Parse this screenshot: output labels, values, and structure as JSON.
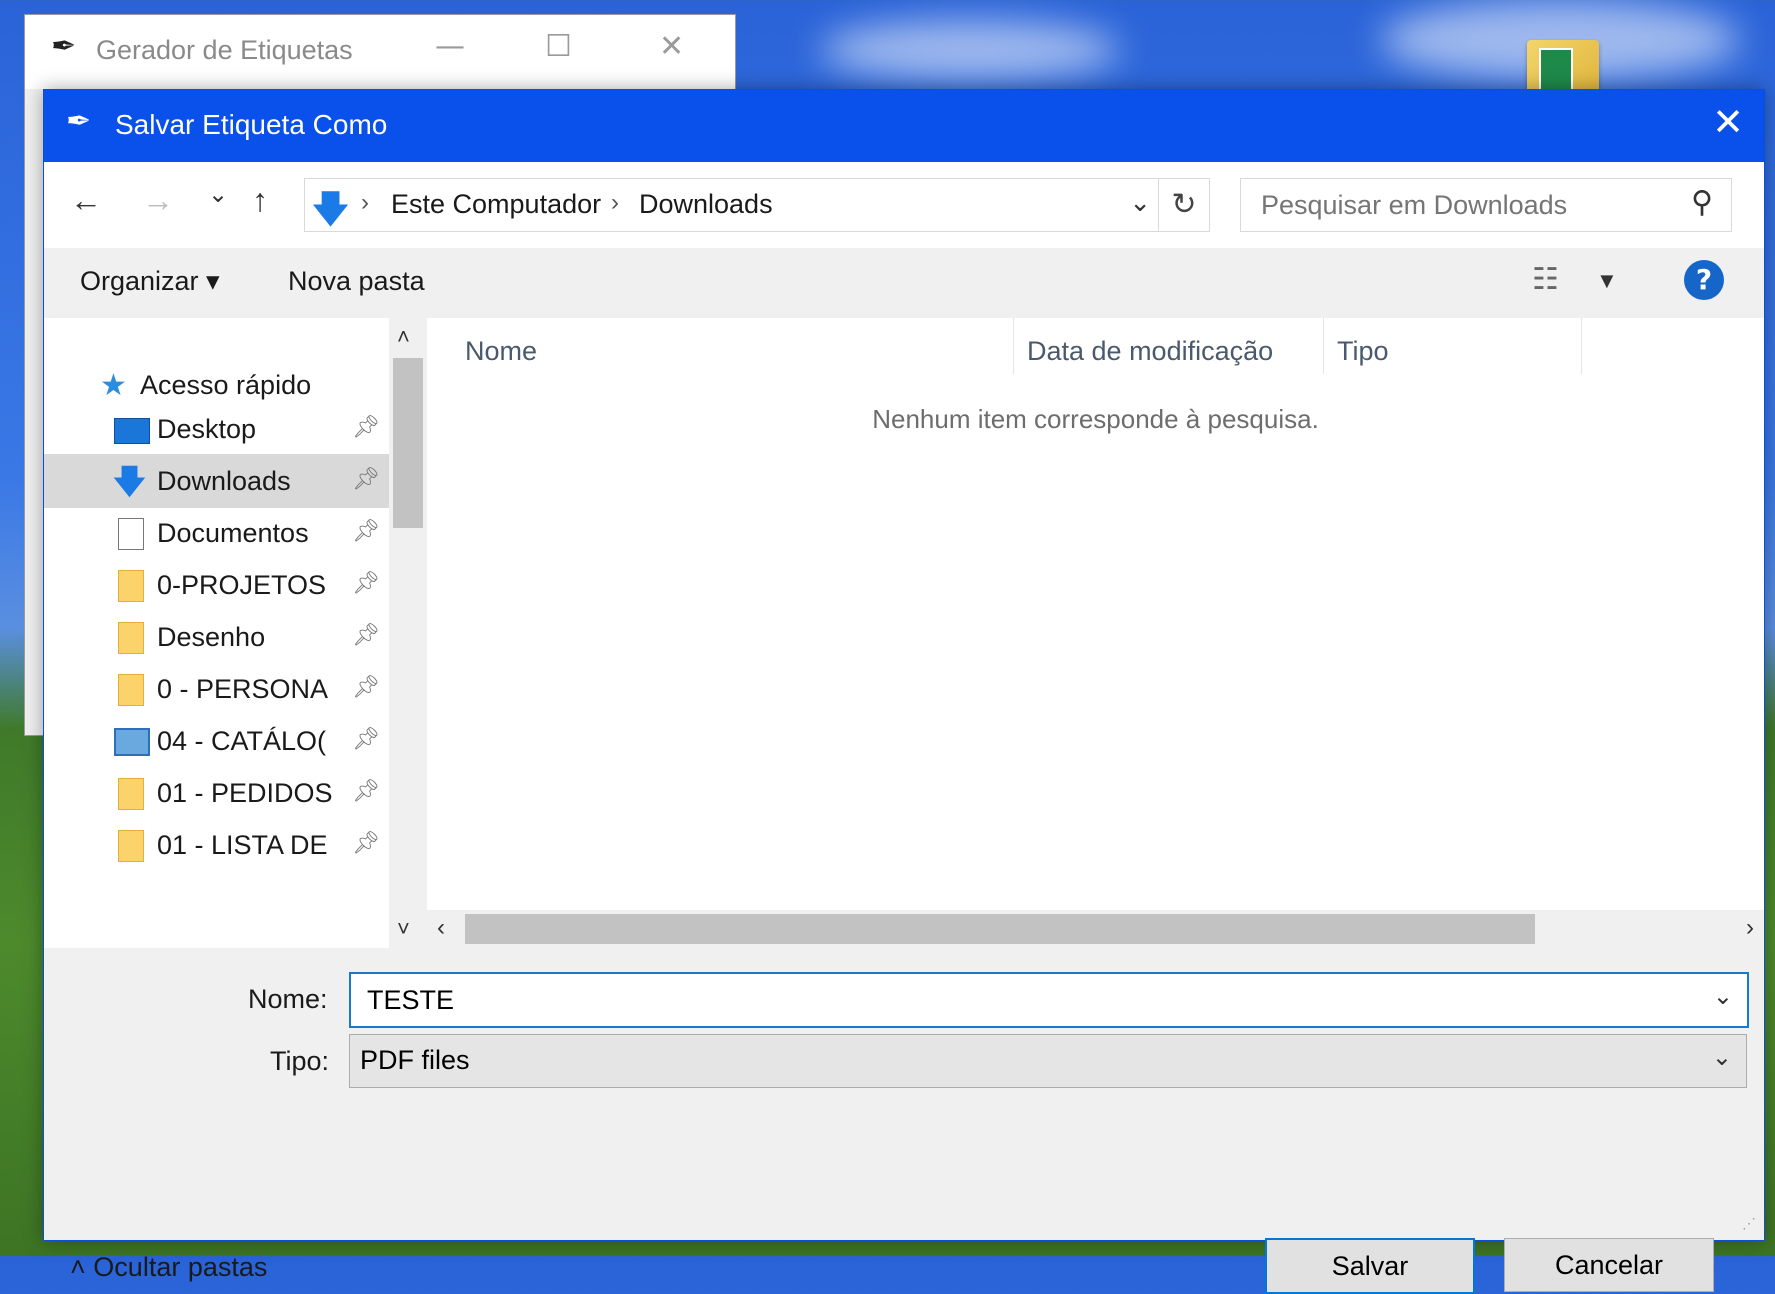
{
  "background_window": {
    "title": "Gerador de Etiquetas",
    "minimize": "—",
    "maximize": "☐",
    "close": "✕"
  },
  "dialog": {
    "title": "Salvar Etiqueta Como",
    "close": "✕"
  },
  "nav": {
    "back": "←",
    "forward": "→",
    "recent": "⌄",
    "up": "↑",
    "breadcrumb": [
      "Este Computador",
      "Downloads"
    ],
    "search_placeholder": "Pesquisar em Downloads"
  },
  "toolbar": {
    "organize": "Organizar ▾",
    "new_folder": "Nova pasta",
    "help": "?"
  },
  "sidebar": {
    "quick_access": "Acesso rápido",
    "items": [
      {
        "label": "Desktop",
        "icon": "desktop-icon"
      },
      {
        "label": "Downloads",
        "icon": "download-icon",
        "selected": true
      },
      {
        "label": "Documentos",
        "icon": "document-icon"
      },
      {
        "label": "0-PROJETOS (",
        "icon": "folder-icon"
      },
      {
        "label": "Desenho",
        "icon": "folder-icon"
      },
      {
        "label": "0 - PERSONA",
        "icon": "folder-icon"
      },
      {
        "label": "04 - CATÁLO(",
        "icon": "image-folder-icon"
      },
      {
        "label": "01 - PEDIDOS",
        "icon": "folder-icon"
      },
      {
        "label": "01 - LISTA DE",
        "icon": "folder-icon"
      }
    ]
  },
  "filelist": {
    "columns": [
      "Nome",
      "Data de modificação",
      "Tipo"
    ],
    "empty_message": "Nenhum item corresponde à pesquisa."
  },
  "form": {
    "name_label": "Nome:",
    "name_value": "TESTE",
    "type_label": "Tipo:",
    "type_value": "PDF files"
  },
  "buttons": {
    "save": "Salvar",
    "cancel": "Cancelar",
    "hide_folders": "Ocultar pastas"
  }
}
